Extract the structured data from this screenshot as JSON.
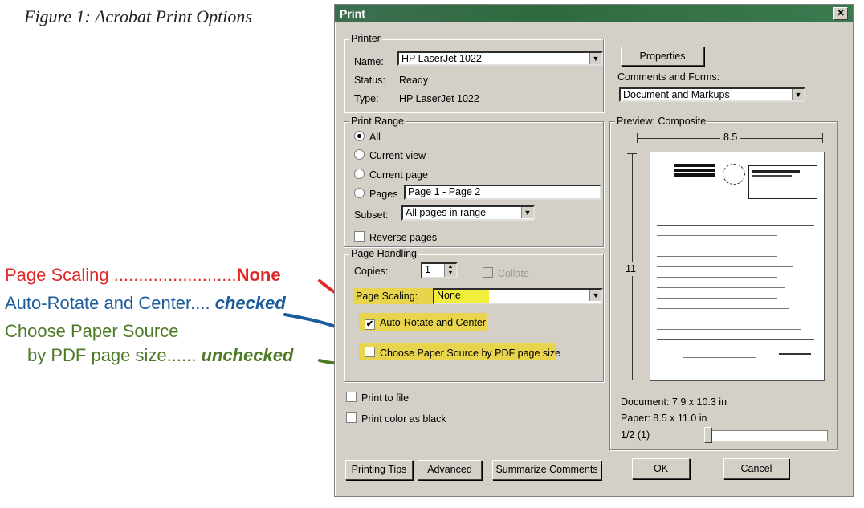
{
  "caption": "Figure 1: Acrobat Print Options",
  "annotations": {
    "scaling_label": "Page Scaling .........................",
    "scaling_value": "None",
    "rotate_label": "Auto-Rotate and Center.... ",
    "rotate_value": "checked",
    "paper_label_1": "Choose Paper Source",
    "paper_label_2": "by PDF page size...... ",
    "paper_value": "unchecked"
  },
  "colors": {
    "red": "#e02a2a",
    "blue": "#1c5c9c",
    "green": "#4d7a25",
    "highlight": "#e8d44d",
    "titlebar": "#2f6a3f"
  },
  "dialog": {
    "title": "Print",
    "close": "✕",
    "printer": {
      "group_label": "Printer",
      "name_label": "Name:",
      "name_value": "HP LaserJet 1022",
      "status_label": "Status:",
      "status_value": "Ready",
      "type_label": "Type:",
      "type_value": "HP LaserJet 1022",
      "properties_button": "Properties",
      "comments_label": "Comments and Forms:",
      "comments_value": "Document and Markups"
    },
    "range": {
      "group_label": "Print Range",
      "all": "All",
      "current_view": "Current view",
      "current_page": "Current page",
      "pages": "Pages",
      "pages_value": "Page 1 - Page 2",
      "subset_label": "Subset:",
      "subset_value": "All pages in range",
      "reverse": "Reverse pages"
    },
    "handling": {
      "group_label": "Page Handling",
      "copies_label": "Copies:",
      "copies_value": "1",
      "collate": "Collate",
      "scaling_label": "Page Scaling:",
      "scaling_value": "None",
      "auto_rotate": "Auto-Rotate and Center",
      "choose_paper": "Choose Paper Source by PDF page size"
    },
    "print_to_file": "Print to file",
    "print_color_black": "Print color as black",
    "preview": {
      "group_label": "Preview: Composite",
      "width": "8.5",
      "height": "11",
      "document_size": "Document: 7.9 x 10.3 in",
      "paper_size": "Paper: 8.5 x 11.0 in",
      "page_indicator": "1/2 (1)"
    },
    "buttons": {
      "printing_tips": "Printing Tips",
      "advanced": "Advanced",
      "summarize": "Summarize Comments",
      "ok": "OK",
      "cancel": "Cancel"
    },
    "checked_mark": "✔",
    "dropdown_arrow": "▼",
    "spin_up": "▲",
    "spin_down": "▼"
  }
}
